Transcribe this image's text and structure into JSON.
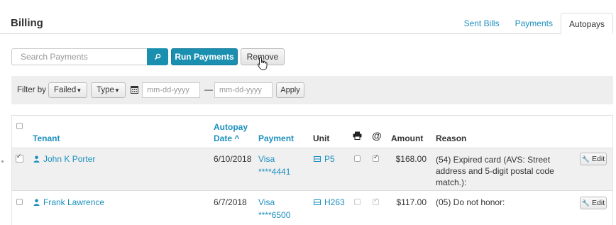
{
  "header": {
    "title": "Billing"
  },
  "tabs": [
    {
      "label": "Sent Bills"
    },
    {
      "label": "Payments"
    },
    {
      "label": "Autopays"
    }
  ],
  "toolbar": {
    "search_placeholder": "Search Payments",
    "search_icon": "search-icon",
    "run_label": "Run Payments",
    "remove_label": "Remove"
  },
  "filter": {
    "label": "Filter by",
    "status": "Failed",
    "type": "Type",
    "date_from_placeholder": "mm-dd-yyyy",
    "date_to_placeholder": "mm-dd-yyyy",
    "separator": "—",
    "apply_label": "Apply"
  },
  "table": {
    "headers": {
      "tenant": "Tenant",
      "autopay_line1": "Autopay",
      "autopay_line2": "Date ^",
      "payment": "Payment",
      "unit": "Unit",
      "print_icon": "printer-icon",
      "email_icon": "at-icon",
      "amount": "Amount",
      "reason": "Reason"
    },
    "rows": [
      {
        "selected": true,
        "tenant": "John K Porter",
        "date": "6/10/2018",
        "payment_line1": "Visa",
        "payment_line2": "****4441",
        "unit": "P5",
        "print": false,
        "email": true,
        "amount": "$168.00",
        "reason_line1": "(54) Expired card (AVS: Street",
        "reason_line2": "address and 5-digit postal code",
        "reason_line3": "match.):",
        "edit_label": "Edit"
      },
      {
        "selected": false,
        "tenant": "Frank Lawrence",
        "date": "6/7/2018",
        "payment_line1": "Visa",
        "payment_line2": "****6500",
        "unit": "H263",
        "print": false,
        "email": true,
        "amount": "$117.00",
        "reason_line1": "(05) Do not honor:",
        "edit_label": "Edit"
      }
    ]
  },
  "colors": {
    "accent": "#1a8fb0",
    "link": "#1c8fbf"
  }
}
